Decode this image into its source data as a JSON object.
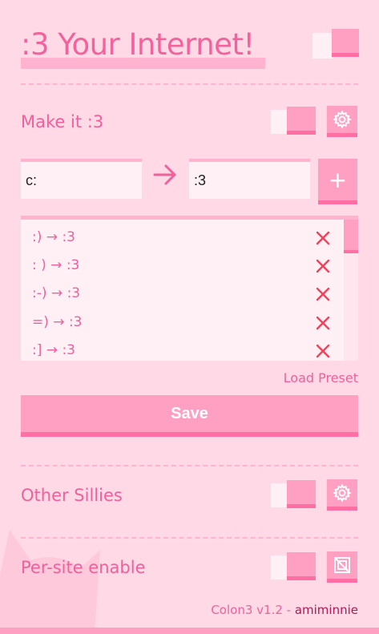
{
  "header": {
    "title": ":3 Your Internet!"
  },
  "make_it": {
    "label": "Make it :3",
    "from_value": "c:",
    "to_value": ":3",
    "add_label": "+"
  },
  "replacements": [
    {
      "from": ":)",
      "to": ":3"
    },
    {
      "from": ": )",
      "to": ":3"
    },
    {
      "from": ":-)",
      "to": ":3"
    },
    {
      "from": "=)",
      "to": ":3"
    },
    {
      "from": ":]",
      "to": ":3"
    }
  ],
  "arrow_glyph": "→",
  "load_preset": "Load Preset",
  "save_label": "Save",
  "other_sillies": {
    "label": "Other Sillies"
  },
  "per_site": {
    "label": "Per-site enable"
  },
  "footer": {
    "version": "Colon3 v1.2 - ",
    "author": "amiminnie"
  },
  "colors": {
    "background": "#ffd9e6",
    "accent": "#ff9fc2",
    "accent_dark": "#ff6fa3",
    "text": "#f0609a",
    "delete": "#f2415a"
  },
  "icons": {
    "settings": "gear-icon",
    "per_site": "site-toggle-icon",
    "delete": "close-icon",
    "arrow": "arrow-right-icon"
  }
}
